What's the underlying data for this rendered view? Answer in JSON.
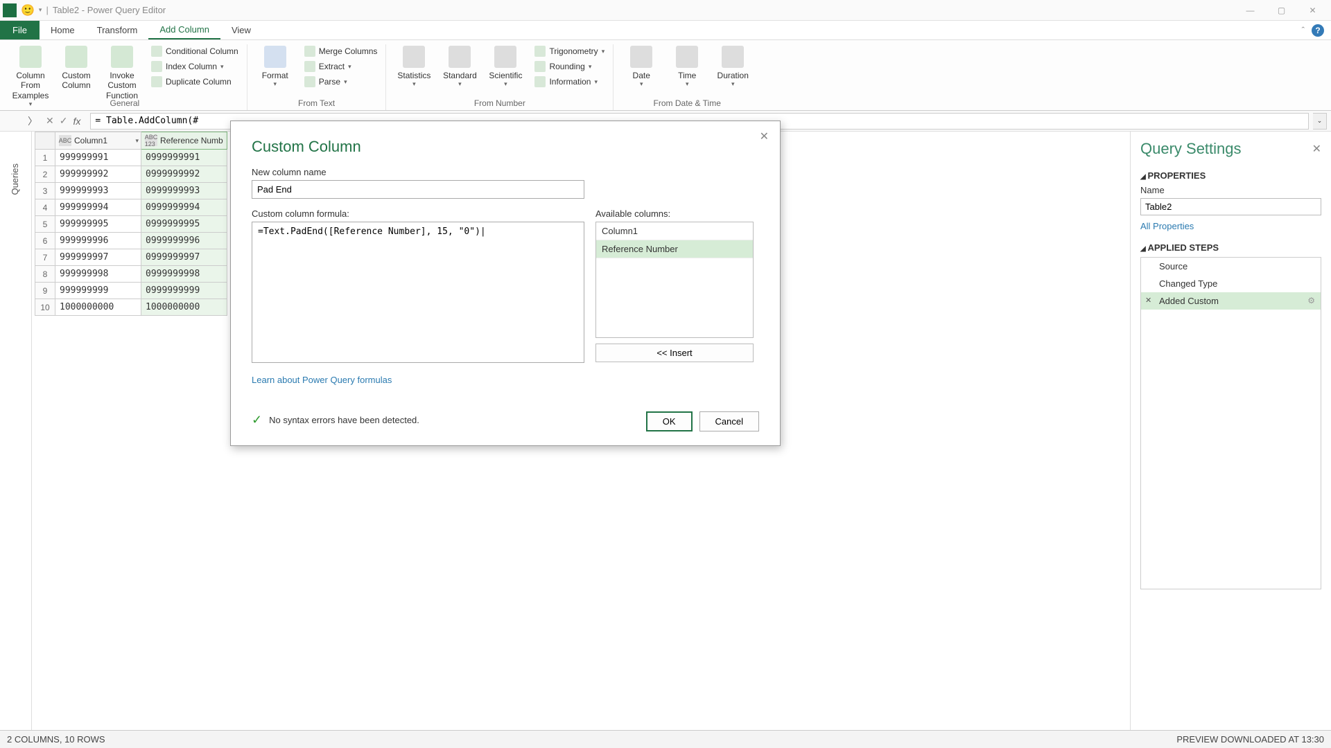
{
  "titlebar": {
    "title": "Table2 - Power Query Editor"
  },
  "tabs": {
    "file": "File",
    "home": "Home",
    "transform": "Transform",
    "addcolumn": "Add Column",
    "view": "View"
  },
  "ribbon": {
    "general": {
      "col_from_examples": "Column From Examples",
      "custom_column": "Custom Column",
      "invoke_custom_fn": "Invoke Custom Function",
      "conditional_column": "Conditional Column",
      "index_column": "Index Column",
      "duplicate_column": "Duplicate Column",
      "label": "General"
    },
    "from_text": {
      "format": "Format",
      "merge_columns": "Merge Columns",
      "extract": "Extract",
      "parse": "Parse",
      "label": "From Text"
    },
    "from_number": {
      "statistics": "Statistics",
      "standard": "Standard",
      "scientific": "Scientific",
      "trigonometry": "Trigonometry",
      "rounding": "Rounding",
      "information": "Information",
      "label": "From Number"
    },
    "from_datetime": {
      "date": "Date",
      "time": "Time",
      "duration": "Duration",
      "label": "From Date & Time"
    }
  },
  "formula_bar": {
    "value": "= Table.AddColumn(#"
  },
  "queries_label": "Queries",
  "grid": {
    "col1_header": "Column1",
    "col2_header": "Reference Numb",
    "rows": [
      {
        "n": "1",
        "c1": "999999991",
        "c2": "0999999991"
      },
      {
        "n": "2",
        "c1": "999999992",
        "c2": "0999999992"
      },
      {
        "n": "3",
        "c1": "999999993",
        "c2": "0999999993"
      },
      {
        "n": "4",
        "c1": "999999994",
        "c2": "0999999994"
      },
      {
        "n": "5",
        "c1": "999999995",
        "c2": "0999999995"
      },
      {
        "n": "6",
        "c1": "999999996",
        "c2": "0999999996"
      },
      {
        "n": "7",
        "c1": "999999997",
        "c2": "0999999997"
      },
      {
        "n": "8",
        "c1": "999999998",
        "c2": "0999999998"
      },
      {
        "n": "9",
        "c1": "999999999",
        "c2": "0999999999"
      },
      {
        "n": "10",
        "c1": "1000000000",
        "c2": "1000000000"
      }
    ]
  },
  "query_settings": {
    "title": "Query Settings",
    "properties_label": "PROPERTIES",
    "name_label": "Name",
    "name_value": "Table2",
    "all_properties": "All Properties",
    "applied_steps_label": "APPLIED STEPS",
    "steps": {
      "s1": "Source",
      "s2": "Changed Type",
      "s3": "Added Custom"
    }
  },
  "dialog": {
    "title": "Custom Column",
    "new_col_label": "New column name",
    "new_col_value": "Pad End",
    "formula_label": "Custom column formula:",
    "formula_value": "=Text.PadEnd([Reference Number], 15, \"0\")|",
    "available_label": "Available columns:",
    "avail1": "Column1",
    "avail2": "Reference Number",
    "insert": "<< Insert",
    "learn_link": "Learn about Power Query formulas",
    "syntax_ok": "No syntax errors have been detected.",
    "ok": "OK",
    "cancel": "Cancel"
  },
  "statusbar": {
    "left": "2 COLUMNS, 10 ROWS",
    "right": "PREVIEW DOWNLOADED AT 13:30"
  }
}
